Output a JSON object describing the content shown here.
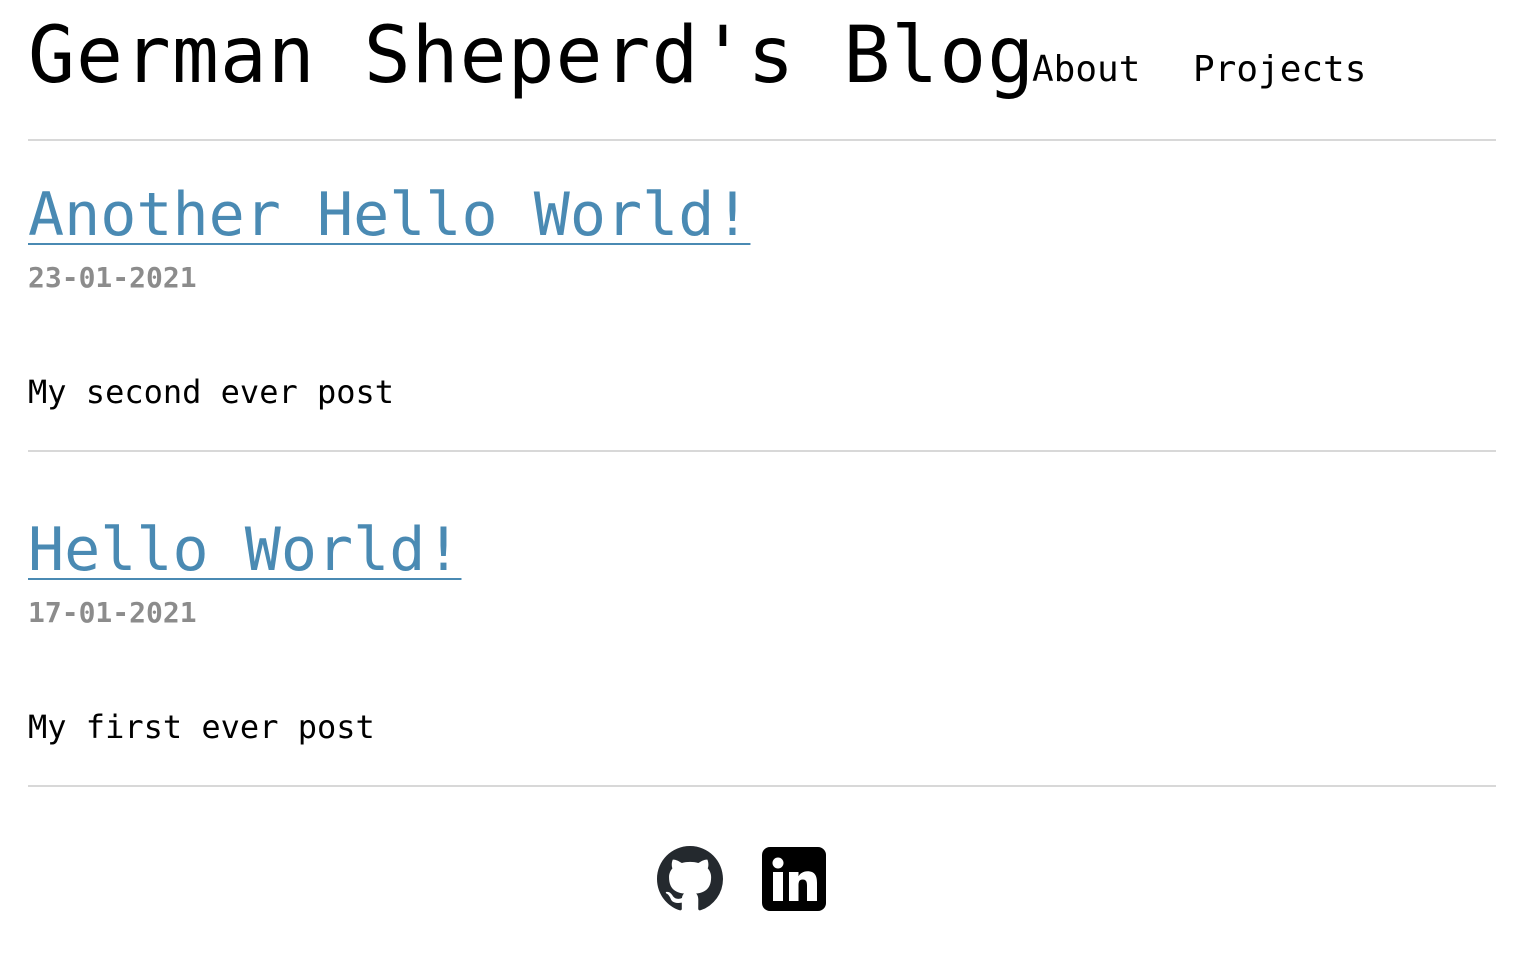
{
  "header": {
    "site_title": "German Sheperd's Blog",
    "nav": [
      {
        "label": "About"
      },
      {
        "label": "Projects"
      }
    ]
  },
  "posts": [
    {
      "title": "Another Hello World!",
      "date": "23-01-2021",
      "excerpt": "My second ever post"
    },
    {
      "title": "Hello World!",
      "date": "17-01-2021",
      "excerpt": "My first ever post"
    }
  ],
  "footer": {
    "social_links": [
      {
        "icon": "github-icon"
      },
      {
        "icon": "linkedin-icon"
      }
    ]
  },
  "colors": {
    "link": "#4a8ab3",
    "date": "#8c8c8c",
    "divider": "#d8d8d8",
    "icon": "#24292e"
  }
}
